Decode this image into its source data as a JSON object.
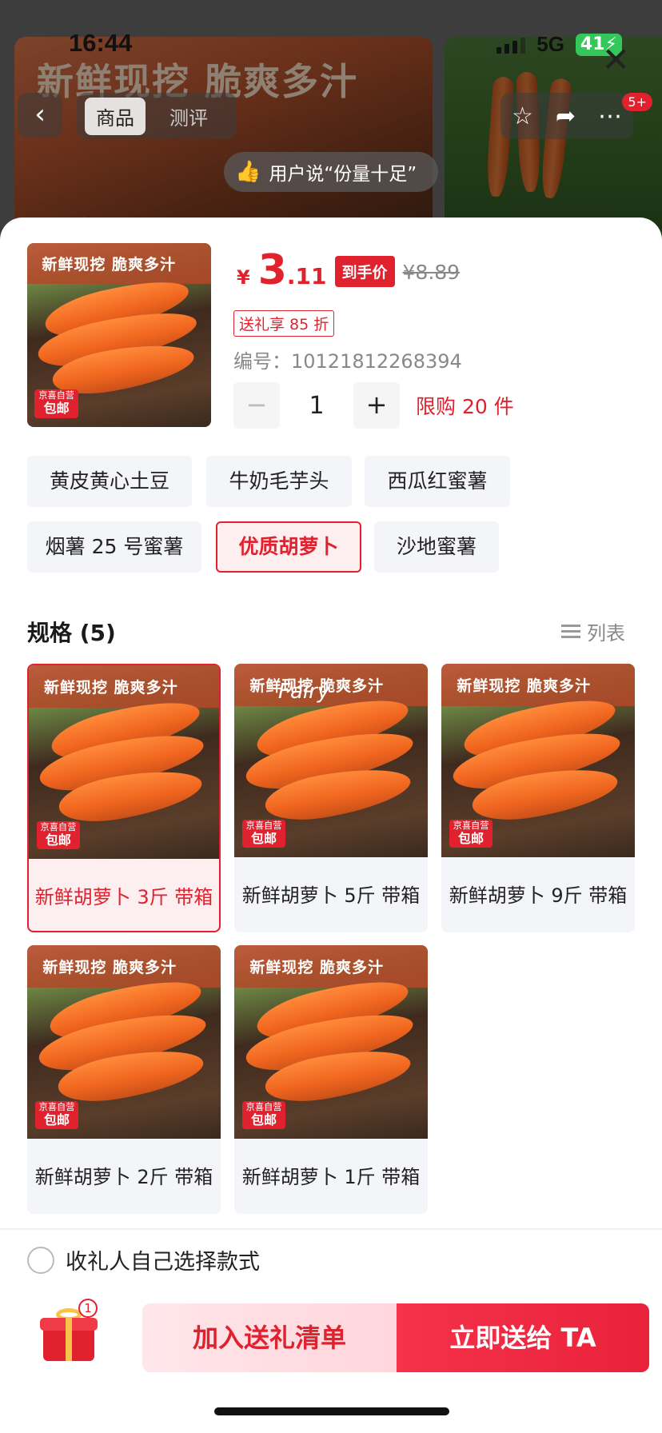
{
  "status": {
    "time": "16:44",
    "network": "5G",
    "battery": "41"
  },
  "background": {
    "hero_text": "新鲜现挖   脆爽多汁",
    "tabs": [
      {
        "label": "商品"
      },
      {
        "label": "测评"
      }
    ],
    "badge": "5+",
    "user_says": "用户说“份量十足”",
    "label": "商品"
  },
  "product": {
    "thumb_title": "新鲜现挖  脆爽多汁",
    "tag_top": "京喜自营",
    "tag_bottom": "包邮",
    "currency": "¥",
    "price_int": "3",
    "price_dec": ".11",
    "price_tag": "到手价",
    "orig_price": "¥8.89",
    "gift_discount": "送礼享 85 折",
    "item_number": "编号：10121812268394",
    "quantity": "1",
    "limit": "限购 20 件"
  },
  "options": [
    {
      "label": "黄皮黄心土豆"
    },
    {
      "label": "牛奶毛芋头"
    },
    {
      "label": "西瓜红蜜薯"
    },
    {
      "label": "烟薯 25 号蜜薯"
    },
    {
      "label": "优质胡萝卜"
    },
    {
      "label": "沙地蜜薯"
    }
  ],
  "spec": {
    "title": "规格 (5)",
    "list_label": "列表",
    "watermark": "Fairy",
    "items": [
      {
        "label": "新鲜胡萝卜 3斤 带箱"
      },
      {
        "label": "新鲜胡萝卜 5斤 带箱"
      },
      {
        "label": "新鲜胡萝卜 9斤 带箱"
      },
      {
        "label": "新鲜胡萝卜 2斤 带箱"
      },
      {
        "label": "新鲜胡萝卜 1斤 带箱"
      }
    ]
  },
  "footer": {
    "self_choose": "收礼人自己选择款式",
    "gift_count": "1",
    "add_label": "加入送礼清单",
    "send_label": "立即送给 TA"
  },
  "colors": {
    "accent": "#e0222e",
    "selected_bg": "#fdeef0",
    "option_bg": "#f4f5f8"
  }
}
